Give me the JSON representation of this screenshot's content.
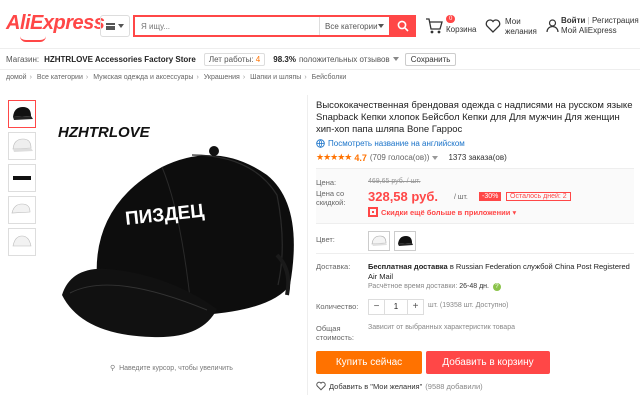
{
  "header": {
    "logo": "AliExpress",
    "search_placeholder": "Я ищу...",
    "search_category": "Все категории",
    "cart_count": "0",
    "cart_label": "Корзина",
    "wishlist_label": "Мои желания",
    "login_label": "Войти",
    "register_label": "Регистрация",
    "account_label": "Мой AliExpress"
  },
  "store": {
    "prefix": "Магазин:",
    "name": "HZHTRLOVE Accessories Factory Store",
    "years_label": "Лет работы:",
    "years_value": "4",
    "rating_value": "98.3%",
    "rating_label": "положительных отзывов",
    "save_label": "Сохранить"
  },
  "breadcrumb": [
    "домой",
    "Все категории",
    "Мужская одежда и аксессуары",
    "Украшения",
    "Шапки и шляпы",
    "Бейсболки"
  ],
  "gallery": {
    "brand_text": "HZHTRLOVE",
    "cap_text": "ПИЗДЕЦ",
    "zoom_hint": "Наведите курсор, чтобы увеличить"
  },
  "product": {
    "title": "Высококачественная брендовая одежда с надписями на русском языке Snapback Кепки хлопок Бейсбол Кепки для Для мужчин Для женщин хип-хоп папа шляпа Bone Гаррос",
    "translate_link": "Посмотреть название на английском",
    "stars": "★★★★★",
    "rating": "4.7",
    "votes": "(709 голоса(ов))",
    "orders": "1373 заказа(ов)"
  },
  "price": {
    "price_label": "Цена:",
    "old_price": "469,65 руб. / шт.",
    "discount_price_label_1": "Цена со",
    "discount_price_label_2": "скидкой:",
    "new_price": "328,58 руб.",
    "per_unit": "/ шт.",
    "discount": "-30%",
    "days_left": "Осталось дней: 2",
    "app_promo": "Скидки ещё больше в приложении"
  },
  "color": {
    "label": "Цвет:"
  },
  "shipping": {
    "label": "Доставка:",
    "main_bold": "Бесплатная доставка",
    "main_rest": "в Russian Federation службой China Post Registered Air Mail",
    "time_label": "Расчётное время доставки:",
    "time_value": "26-48 дн."
  },
  "quantity": {
    "label": "Количество:",
    "minus": "−",
    "value": "1",
    "plus": "+",
    "note": "шт. (19358 шт. Доступно)"
  },
  "total": {
    "label_1": "Общая",
    "label_2": "стоимость:",
    "value": "Зависит от выбранных характеристик товара"
  },
  "actions": {
    "buy_now": "Купить сейчас",
    "add_to_cart": "Добавить в корзину",
    "wishlist_add": "Добавить в \"Мои желания\"",
    "wishlist_count": "(9588 добавили)"
  },
  "colors": {
    "brand_red": "#ff4747",
    "orange": "#ff7200",
    "link_blue": "#1a73c9"
  }
}
